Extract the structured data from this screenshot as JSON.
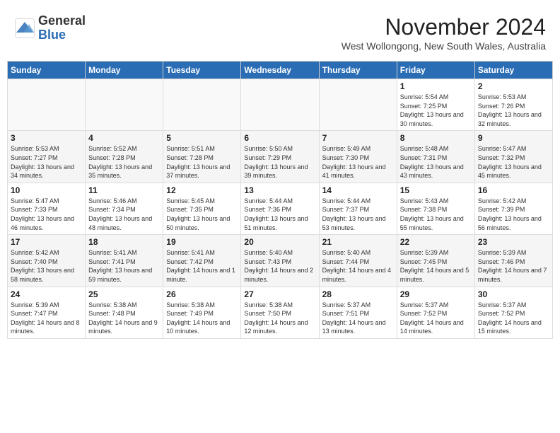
{
  "logo": {
    "general": "General",
    "blue": "Blue"
  },
  "header": {
    "month": "November 2024",
    "location": "West Wollongong, New South Wales, Australia"
  },
  "days_of_week": [
    "Sunday",
    "Monday",
    "Tuesday",
    "Wednesday",
    "Thursday",
    "Friday",
    "Saturday"
  ],
  "weeks": [
    [
      {
        "day": "",
        "info": ""
      },
      {
        "day": "",
        "info": ""
      },
      {
        "day": "",
        "info": ""
      },
      {
        "day": "",
        "info": ""
      },
      {
        "day": "",
        "info": ""
      },
      {
        "day": "1",
        "info": "Sunrise: 5:54 AM\nSunset: 7:25 PM\nDaylight: 13 hours and 30 minutes."
      },
      {
        "day": "2",
        "info": "Sunrise: 5:53 AM\nSunset: 7:26 PM\nDaylight: 13 hours and 32 minutes."
      }
    ],
    [
      {
        "day": "3",
        "info": "Sunrise: 5:53 AM\nSunset: 7:27 PM\nDaylight: 13 hours and 34 minutes."
      },
      {
        "day": "4",
        "info": "Sunrise: 5:52 AM\nSunset: 7:28 PM\nDaylight: 13 hours and 35 minutes."
      },
      {
        "day": "5",
        "info": "Sunrise: 5:51 AM\nSunset: 7:28 PM\nDaylight: 13 hours and 37 minutes."
      },
      {
        "day": "6",
        "info": "Sunrise: 5:50 AM\nSunset: 7:29 PM\nDaylight: 13 hours and 39 minutes."
      },
      {
        "day": "7",
        "info": "Sunrise: 5:49 AM\nSunset: 7:30 PM\nDaylight: 13 hours and 41 minutes."
      },
      {
        "day": "8",
        "info": "Sunrise: 5:48 AM\nSunset: 7:31 PM\nDaylight: 13 hours and 43 minutes."
      },
      {
        "day": "9",
        "info": "Sunrise: 5:47 AM\nSunset: 7:32 PM\nDaylight: 13 hours and 45 minutes."
      }
    ],
    [
      {
        "day": "10",
        "info": "Sunrise: 5:47 AM\nSunset: 7:33 PM\nDaylight: 13 hours and 46 minutes."
      },
      {
        "day": "11",
        "info": "Sunrise: 5:46 AM\nSunset: 7:34 PM\nDaylight: 13 hours and 48 minutes."
      },
      {
        "day": "12",
        "info": "Sunrise: 5:45 AM\nSunset: 7:35 PM\nDaylight: 13 hours and 50 minutes."
      },
      {
        "day": "13",
        "info": "Sunrise: 5:44 AM\nSunset: 7:36 PM\nDaylight: 13 hours and 51 minutes."
      },
      {
        "day": "14",
        "info": "Sunrise: 5:44 AM\nSunset: 7:37 PM\nDaylight: 13 hours and 53 minutes."
      },
      {
        "day": "15",
        "info": "Sunrise: 5:43 AM\nSunset: 7:38 PM\nDaylight: 13 hours and 55 minutes."
      },
      {
        "day": "16",
        "info": "Sunrise: 5:42 AM\nSunset: 7:39 PM\nDaylight: 13 hours and 56 minutes."
      }
    ],
    [
      {
        "day": "17",
        "info": "Sunrise: 5:42 AM\nSunset: 7:40 PM\nDaylight: 13 hours and 58 minutes."
      },
      {
        "day": "18",
        "info": "Sunrise: 5:41 AM\nSunset: 7:41 PM\nDaylight: 13 hours and 59 minutes."
      },
      {
        "day": "19",
        "info": "Sunrise: 5:41 AM\nSunset: 7:42 PM\nDaylight: 14 hours and 1 minute."
      },
      {
        "day": "20",
        "info": "Sunrise: 5:40 AM\nSunset: 7:43 PM\nDaylight: 14 hours and 2 minutes."
      },
      {
        "day": "21",
        "info": "Sunrise: 5:40 AM\nSunset: 7:44 PM\nDaylight: 14 hours and 4 minutes."
      },
      {
        "day": "22",
        "info": "Sunrise: 5:39 AM\nSunset: 7:45 PM\nDaylight: 14 hours and 5 minutes."
      },
      {
        "day": "23",
        "info": "Sunrise: 5:39 AM\nSunset: 7:46 PM\nDaylight: 14 hours and 7 minutes."
      }
    ],
    [
      {
        "day": "24",
        "info": "Sunrise: 5:39 AM\nSunset: 7:47 PM\nDaylight: 14 hours and 8 minutes."
      },
      {
        "day": "25",
        "info": "Sunrise: 5:38 AM\nSunset: 7:48 PM\nDaylight: 14 hours and 9 minutes."
      },
      {
        "day": "26",
        "info": "Sunrise: 5:38 AM\nSunset: 7:49 PM\nDaylight: 14 hours and 10 minutes."
      },
      {
        "day": "27",
        "info": "Sunrise: 5:38 AM\nSunset: 7:50 PM\nDaylight: 14 hours and 12 minutes."
      },
      {
        "day": "28",
        "info": "Sunrise: 5:37 AM\nSunset: 7:51 PM\nDaylight: 14 hours and 13 minutes."
      },
      {
        "day": "29",
        "info": "Sunrise: 5:37 AM\nSunset: 7:52 PM\nDaylight: 14 hours and 14 minutes."
      },
      {
        "day": "30",
        "info": "Sunrise: 5:37 AM\nSunset: 7:52 PM\nDaylight: 14 hours and 15 minutes."
      }
    ]
  ]
}
